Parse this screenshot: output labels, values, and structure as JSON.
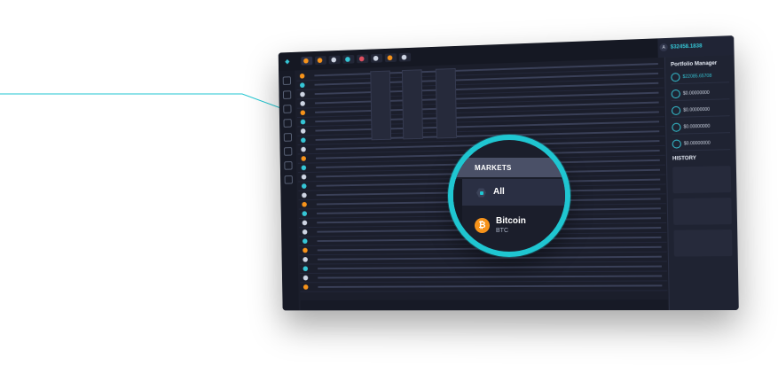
{
  "topbar": {
    "logo_text": "",
    "balance": "$32458.1838",
    "avatar_letter": "A",
    "tickers": [
      "",
      "",
      "",
      "",
      "",
      "",
      "",
      "",
      "",
      ""
    ]
  },
  "portfolio": {
    "title": "Portfolio Manager",
    "total": "$22085.65708",
    "wallets": [
      "$0.00000000",
      "$0.00000000",
      "$0.00000000",
      "$0.00000000"
    ]
  },
  "history": {
    "title": "HISTORY"
  },
  "magnifier": {
    "header": "MARKETS",
    "all_label": "All",
    "coin_name": "Bitcoin",
    "coin_symbol": "BTC"
  },
  "colors": {
    "accent": "#1fc6d1",
    "bitcoin": "#f7931a",
    "bg": "#1b1e2b"
  }
}
